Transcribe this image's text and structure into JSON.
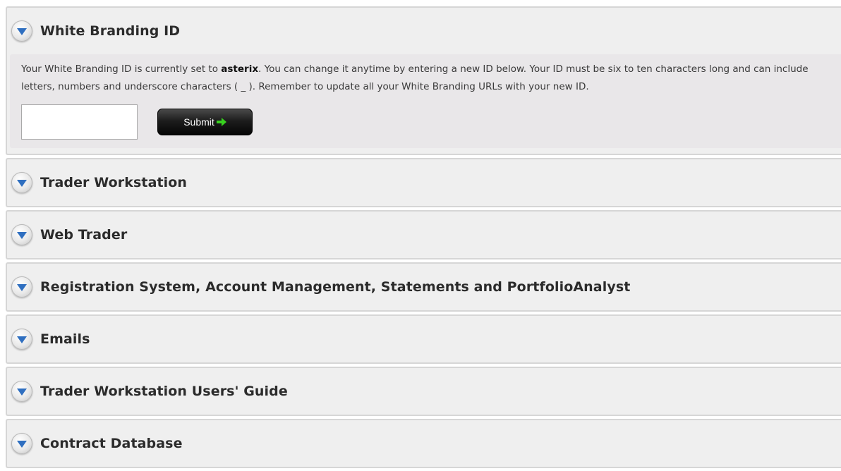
{
  "sections": [
    {
      "title": "White Branding ID",
      "expanded": true,
      "body": {
        "text_before": "Your White Branding ID is currently set to ",
        "current_id": "asterix",
        "text_after": ". You can change it anytime by entering a new ID below. Your ID must be six to ten characters long and can include letters, numbers and underscore characters ( _ ). Remember to update all your White Branding URLs with your new ID.",
        "input_value": "",
        "submit_label": "Submit"
      }
    },
    {
      "title": "Trader Workstation",
      "expanded": false
    },
    {
      "title": "Web Trader",
      "expanded": false
    },
    {
      "title": "Registration System, Account Management, Statements and PortfolioAnalyst",
      "expanded": false
    },
    {
      "title": "Emails",
      "expanded": false
    },
    {
      "title": "Trader Workstation Users' Guide",
      "expanded": false
    },
    {
      "title": "Contract Database",
      "expanded": false
    }
  ],
  "icons": {
    "toggle": "chevron-down-icon",
    "submit_arrow": "arrow-right-icon"
  },
  "colors": {
    "toggle_arrow": "#2f6fc0",
    "submit_arrow": "#38d11f",
    "panel_bg": "#efefef",
    "body_bg": "#e9e7e9"
  }
}
